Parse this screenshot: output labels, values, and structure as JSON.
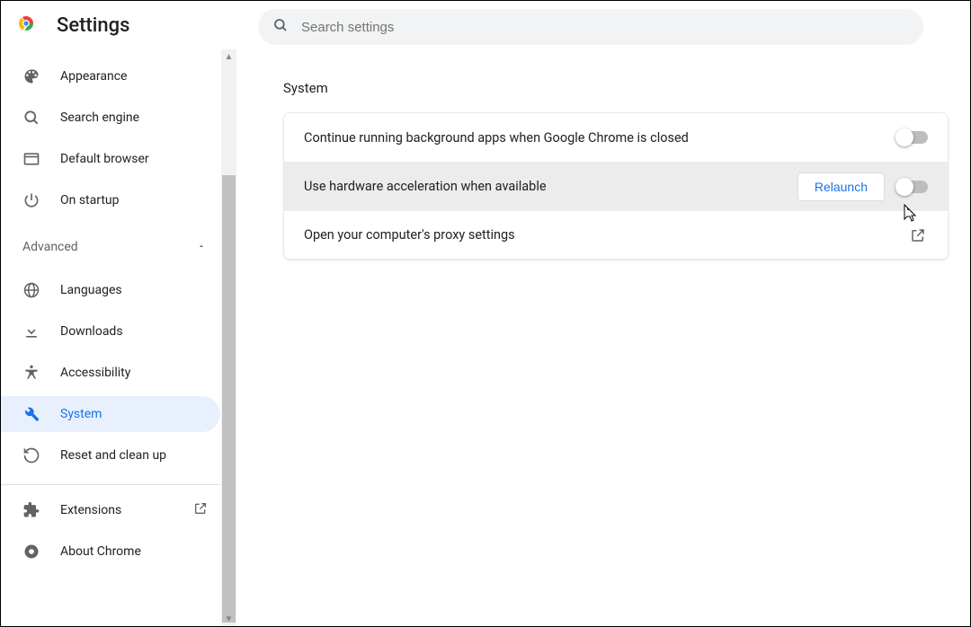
{
  "header": {
    "title": "Settings",
    "search_placeholder": "Search settings"
  },
  "sidebar": {
    "items": [
      {
        "id": "appearance",
        "label": "Appearance",
        "icon": "palette"
      },
      {
        "id": "search-engine",
        "label": "Search engine",
        "icon": "search"
      },
      {
        "id": "default-browser",
        "label": "Default browser",
        "icon": "browser"
      },
      {
        "id": "on-startup",
        "label": "On startup",
        "icon": "power"
      }
    ],
    "advanced_label": "Advanced",
    "advanced_items": [
      {
        "id": "languages",
        "label": "Languages",
        "icon": "globe"
      },
      {
        "id": "downloads",
        "label": "Downloads",
        "icon": "download"
      },
      {
        "id": "accessibility",
        "label": "Accessibility",
        "icon": "accessibility"
      },
      {
        "id": "system",
        "label": "System",
        "icon": "wrench",
        "active": true
      },
      {
        "id": "reset",
        "label": "Reset and clean up",
        "icon": "restore"
      }
    ],
    "footer_items": [
      {
        "id": "extensions",
        "label": "Extensions",
        "icon": "extension",
        "external": true
      },
      {
        "id": "about",
        "label": "About Chrome",
        "icon": "chrome"
      }
    ]
  },
  "main": {
    "section_title": "System",
    "rows": [
      {
        "label": "Continue running background apps when Google Chrome is closed",
        "toggle": false
      },
      {
        "label": "Use hardware acceleration when available",
        "toggle": false,
        "relaunch_label": "Relaunch",
        "highlight": true
      },
      {
        "label": "Open your computer's proxy settings",
        "external": true
      }
    ]
  }
}
